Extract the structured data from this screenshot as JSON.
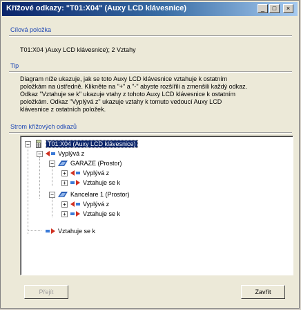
{
  "window": {
    "title": "Křížové odkazy: \"T01:X04\" (Auxy LCD klávesnice)"
  },
  "titlebar_buttons": {
    "minimize": "_",
    "maximize": "□",
    "close": "×"
  },
  "target": {
    "heading": "Cílová položka",
    "text": "T01:X04 )Auxy LCD klávesnice); 2 Vztahy"
  },
  "tip": {
    "heading": "Tip",
    "lines": [
      "Diagram níže ukazuje, jak se toto Auxy LCD klávesnice vztahuje k ostatním",
      "položkám na ústředně. Klikněte na \"+\" a \"-\" abyste rozšířili a zmenšili každý odkaz.",
      "Odkaz \"Vztahuje se k\" ukazuje vtahy z tohoto Auxy LCD klávesnice k ostatním",
      "položkám. Odkaz \"Vyplývá z\" ukazuje vztahy k tomuto vedoucí Auxy LCD",
      "klávesnice z ostatních položek."
    ]
  },
  "tree": {
    "heading": "Strom křížových odkazů",
    "root": "T01:X04 (Auxy LCD klávesnice)",
    "vyplyva": "Vyplývá z",
    "garaze": "GARAZE (Prostor)",
    "garaze_vyplyva": "Vyplývá z",
    "garaze_vztahuje": "Vztahuje se k",
    "kancelare": "Kancelare 1 (Prostor)",
    "kancelare_vyplyva": "Vyplývá z",
    "kancelare_vztahuje": "Vztahuje se k",
    "vztahuje": "Vztahuje se k",
    "expand_minus": "−",
    "expand_plus": "+"
  },
  "buttons": {
    "back": "Přejít",
    "close": "Zavřít"
  },
  "colors": {
    "heading": "#1c46b4",
    "selection": "#0a246a",
    "arrow": "#d03020",
    "folder_blue": "#2a5fb8"
  }
}
